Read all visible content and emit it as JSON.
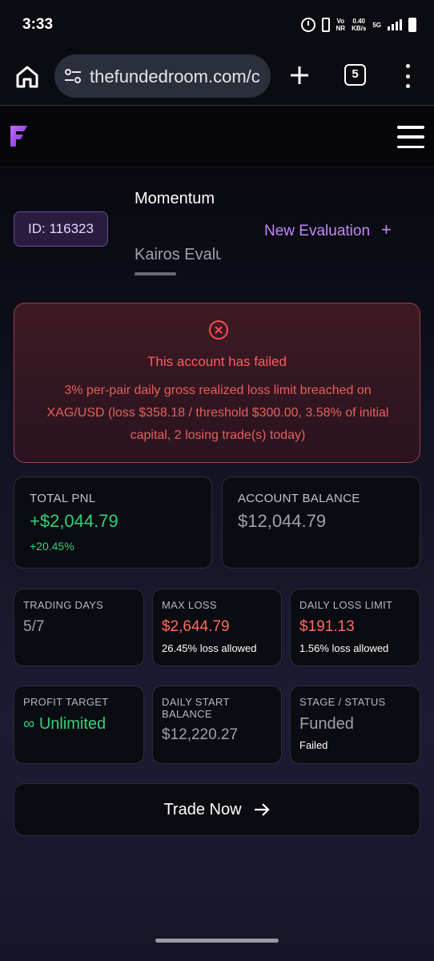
{
  "status_bar": {
    "time": "3:33",
    "net_top": "Vo",
    "net_bottom": "NR",
    "speed_top": "0.40",
    "speed_bottom": "KB/s",
    "signal": "5G"
  },
  "browser": {
    "url": "thefundedroom.com/c",
    "tab_count": "5"
  },
  "account": {
    "id_label": "ID: 116323",
    "tabs": [
      {
        "label": "Momentum"
      },
      {
        "label": "Kairos Evaluation"
      }
    ],
    "new_evaluation_label": "New Evaluation",
    "new_evaluation_plus": "+"
  },
  "alert": {
    "title": "This account has failed",
    "message": "3% per-pair daily gross realized loss limit breached on XAG/USD (loss $358.18 / threshold $300.00, 3.58% of initial capital, 2 losing trade(s) today)"
  },
  "stats": {
    "total_pnl": {
      "label": "TOTAL PNL",
      "value": "+$2,044.79",
      "sub": "+20.45%"
    },
    "account_balance": {
      "label": "ACCOUNT BALANCE",
      "value": "$12,044.79"
    },
    "trading_days": {
      "label": "TRADING DAYS",
      "value": "5/7"
    },
    "max_loss": {
      "label": "MAX LOSS",
      "value": "$2,644.79",
      "sub": "26.45% loss allowed"
    },
    "daily_loss_limit": {
      "label": "DAILY LOSS LIMIT",
      "value": "$191.13",
      "sub": "1.56% loss allowed"
    },
    "profit_target": {
      "label": "PROFIT TARGET",
      "value": "∞ Unlimited"
    },
    "daily_start_balance": {
      "label_line1": "DAILY START",
      "label_line2": "BALANCE",
      "value": "$12,220.27"
    },
    "stage_status": {
      "label": "STAGE / STATUS",
      "value": "Funded",
      "sub": "Failed"
    }
  },
  "trade_button": {
    "label": "Trade Now"
  },
  "colors": {
    "accent_purple": "#c487ff",
    "positive": "#33d17a",
    "negative": "#ff6b5e",
    "alert_red": "#ff5a5f"
  }
}
